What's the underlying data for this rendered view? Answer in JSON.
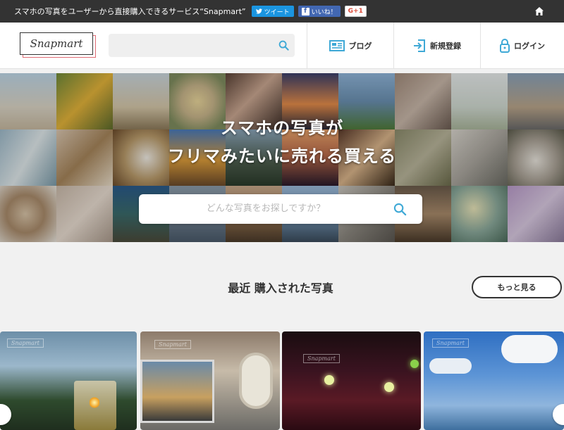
{
  "topbar": {
    "tagline": "スマホの写真をユーザーから直接購入できるサービス“Snapmart”",
    "tweet_label": "ツイート",
    "like_label": "いいね！",
    "gplus_label": "G+1"
  },
  "header": {
    "logo_text": "Snapmart",
    "search": {
      "placeholder": "",
      "value": ""
    },
    "nav": {
      "blog": "ブログ",
      "signup": "新規登録",
      "login": "ログイン"
    }
  },
  "hero": {
    "line1": "スマホの写真が",
    "line2": "フリマみたいに売れる買える",
    "search_placeholder": "どんな写真をお探しですか？"
  },
  "recent": {
    "title": "最近 購入された写真",
    "more_label": "もっと見る",
    "watermark": "Snapmart"
  },
  "colors": {
    "topbar": "#333333",
    "accent": "#3fa9d6",
    "logo_shadow": "#e06a74"
  },
  "icons": [
    "home-icon",
    "search-icon",
    "blog-icon",
    "signup-icon",
    "lock-icon",
    "twitter-icon",
    "facebook-icon"
  ]
}
